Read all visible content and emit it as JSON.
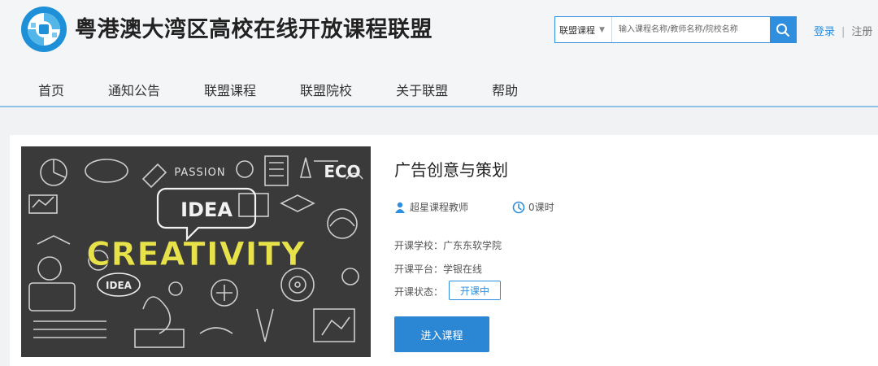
{
  "header": {
    "site_title": "粤港澳大湾区高校在线开放课程联盟",
    "search": {
      "category": "联盟课程",
      "placeholder": "输入课程名称/教师名称/院校名称"
    },
    "auth": {
      "login": "登录",
      "separator": "|",
      "register": "注册"
    }
  },
  "nav": {
    "items": [
      {
        "label": "首页"
      },
      {
        "label": "通知公告"
      },
      {
        "label": "联盟课程"
      },
      {
        "label": "联盟院校"
      },
      {
        "label": "关于联盟"
      },
      {
        "label": "帮助"
      }
    ]
  },
  "course": {
    "title": "广告创意与策划",
    "teacher": "超星课程教师",
    "hours": "0课时",
    "school_label": "开课学校：",
    "school": "广东东软学院",
    "platform_label": "开课平台：",
    "platform": "学银在线",
    "status_label": "开课状态：",
    "status": "开课中",
    "enter_button": "进入课程",
    "cover": {
      "idea_bubble": "IDEA",
      "creativity": "CREATIVITY",
      "eco": "ECO",
      "passion": "PASSION",
      "idea_small": "IDEA"
    }
  },
  "colors": {
    "accent": "#2f8fde",
    "button": "#2b86d4",
    "cover_bg": "#3a3a3a",
    "cover_text": "#e7e24a"
  }
}
